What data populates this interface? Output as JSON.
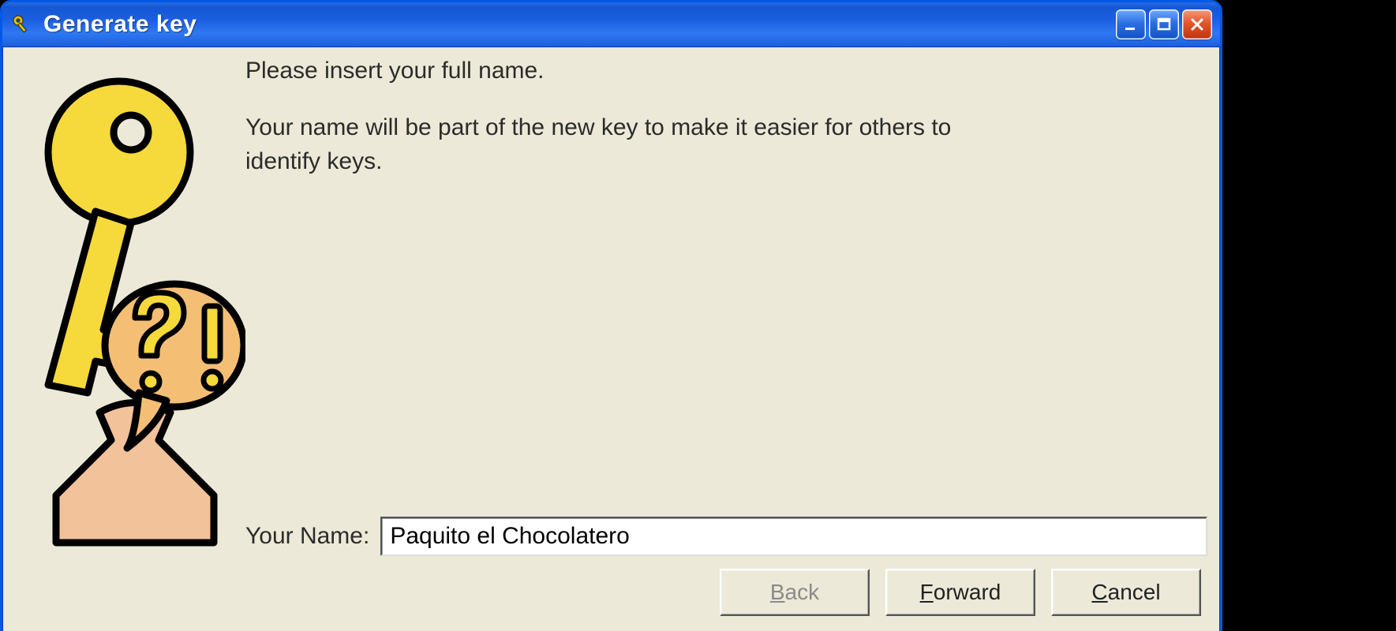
{
  "window": {
    "title": "Generate key"
  },
  "content": {
    "para1": "Please insert your full name.",
    "para2": "Your name will be part of the new key to make it easier for others to identify keys."
  },
  "field": {
    "label": "Your Name:",
    "value": "Paquito el Chocolatero"
  },
  "buttons": {
    "back_pre": "",
    "back_mnemonic": "B",
    "back_post": "ack",
    "back_disabled": true,
    "forward_pre": "",
    "forward_mnemonic": "F",
    "forward_post": "orward",
    "cancel_pre": "",
    "cancel_mnemonic": "C",
    "cancel_post": "ancel"
  }
}
